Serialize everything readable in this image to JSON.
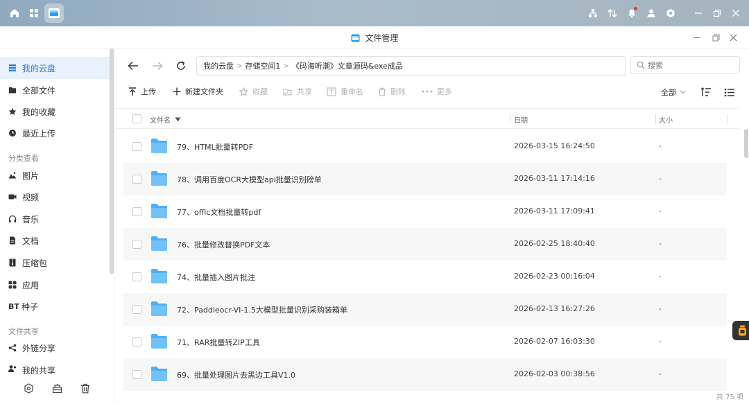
{
  "window": {
    "title": "文件管理"
  },
  "sidebar": {
    "items": [
      {
        "label": "我的云盘",
        "icon": "cloud-list-icon",
        "active": true
      },
      {
        "label": "全部文件",
        "icon": "folder-icon"
      },
      {
        "label": "我的收藏",
        "icon": "star-icon"
      },
      {
        "label": "最近上传",
        "icon": "clock-icon"
      }
    ],
    "section_category": "分类查看",
    "categories": [
      {
        "label": "图片",
        "icon": "image-icon"
      },
      {
        "label": "视频",
        "icon": "video-icon"
      },
      {
        "label": "音乐",
        "icon": "headphones-icon"
      },
      {
        "label": "文档",
        "icon": "document-icon"
      },
      {
        "label": "压缩包",
        "icon": "archive-icon"
      },
      {
        "label": "应用",
        "icon": "apps-icon"
      },
      {
        "label": "种子",
        "icon_text": "BT"
      }
    ],
    "section_share": "文件共享",
    "share_items": [
      {
        "label": "外链分享",
        "icon": "share-icon"
      },
      {
        "label": "我的共享",
        "icon": "user-share-icon"
      }
    ]
  },
  "breadcrumb": [
    "我的云盘",
    "存储空间1",
    "《码海听潮》文章源码&exe成品"
  ],
  "search": {
    "placeholder": "搜索"
  },
  "toolbar": {
    "upload": "上传",
    "new_folder": "新建文件夹",
    "favorite": "收藏",
    "share": "共享",
    "rename": "重命名",
    "delete": "删除",
    "more": "更多",
    "filter": "全部"
  },
  "table": {
    "columns": {
      "name": "文件名",
      "date": "日期",
      "size": "大小"
    },
    "rows": [
      {
        "name": "79、HTML批量转PDF",
        "date": "2026-03-15 16:24:50",
        "size": "-"
      },
      {
        "name": "78、调用百度OCR大模型api批量识别磅单",
        "date": "2026-03-11 17:14:16",
        "size": "-"
      },
      {
        "name": "77、offic文档批量转pdf",
        "date": "2026-03-11 17:09:41",
        "size": "-"
      },
      {
        "name": "76、批量修改替换PDF文本",
        "date": "2026-02-25 18:40:40",
        "size": "-"
      },
      {
        "name": "74、批量插入图片批注",
        "date": "2026-02-23 00:16:04",
        "size": "-"
      },
      {
        "name": "72、Paddleocr-VI-1.5大模型批量识别采购装箱单",
        "date": "2026-02-13 16:27:26",
        "size": "-"
      },
      {
        "name": "71、RAR批量转ZIP工具",
        "date": "2026-02-07 16:03:30",
        "size": "-"
      },
      {
        "name": "69、批量处理图片去黑边工具V1.0",
        "date": "2026-02-03 00:38:56",
        "size": "-"
      }
    ]
  },
  "footer": {
    "total": "共 75 项"
  },
  "colors": {
    "accent": "#2a7de1",
    "folder": "#4fb0f5",
    "active_bg": "#e8f1fc"
  }
}
